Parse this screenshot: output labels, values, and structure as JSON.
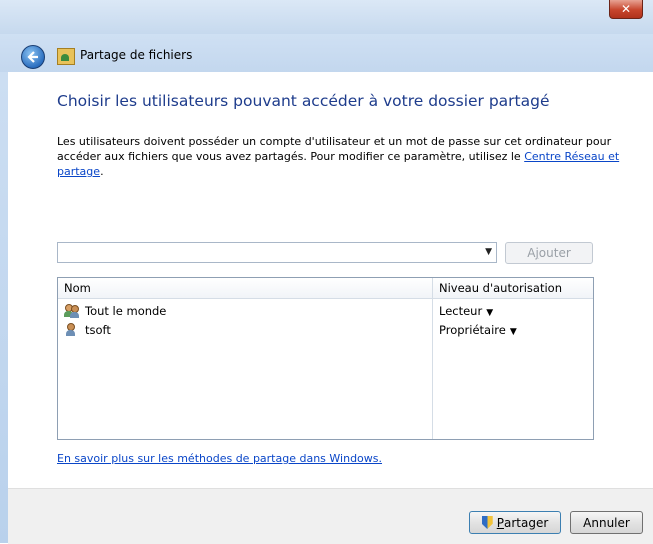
{
  "window": {
    "title": "Partage de fichiers",
    "close_glyph": "✕"
  },
  "main": {
    "heading": "Choisir les utilisateurs pouvant accéder à votre dossier partagé",
    "description_prefix": "Les utilisateurs doivent posséder un compte d'utilisateur et un mot de passe sur cet ordinateur pour accéder aux fichiers que vous avez partagés. Pour modifier ce paramètre, utilisez le ",
    "description_link": "Centre Réseau et partage",
    "description_suffix": "."
  },
  "combo": {
    "value": "",
    "arrow_glyph": "▼"
  },
  "add_button": {
    "label_pre": "A",
    "label_accel": "j",
    "label_post": "outer"
  },
  "list": {
    "headers": {
      "name": "Nom",
      "level": "Niveau d'autorisation"
    },
    "rows": [
      {
        "name": "Tout le monde",
        "permission": "Lecteur",
        "icon": "group-users-icon"
      },
      {
        "name": "tsoft",
        "permission": "Propriétaire",
        "icon": "user-icon"
      }
    ],
    "dropdown_glyph": "▼"
  },
  "learn_more_link": "En savoir plus sur les méthodes de partage dans Windows.",
  "footer": {
    "share_accel": "P",
    "share_rest": "artager",
    "cancel_label": "Annuler"
  },
  "colors": {
    "heading": "#1e3c8c",
    "link": "#0a46c8",
    "frame": "#c6d9ee"
  }
}
